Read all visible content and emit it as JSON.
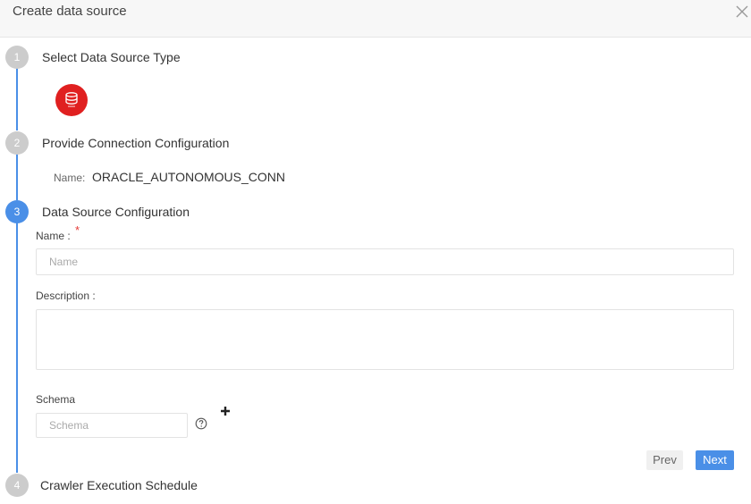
{
  "dialog": {
    "title": "Create data source"
  },
  "steps": [
    {
      "number": "1",
      "title": "Select Data Source Type"
    },
    {
      "number": "2",
      "title": "Provide Connection Configuration"
    },
    {
      "number": "3",
      "title": "Data Source Configuration"
    },
    {
      "number": "4",
      "title": "Crawler Execution Schedule"
    }
  ],
  "data_source_type": {
    "icon": "oracle-database-icon",
    "color": "#e02020"
  },
  "connection": {
    "name_label": "Name:",
    "name_value": "ORACLE_AUTONOMOUS_CONN"
  },
  "form": {
    "name_label": "Name :",
    "name_required_mark": "*",
    "name_placeholder": "Name",
    "description_label": "Description :",
    "schema_label": "Schema",
    "schema_placeholder": "Schema"
  },
  "buttons": {
    "prev": "Prev",
    "next": "Next"
  },
  "colors": {
    "accent": "#4a8fe7",
    "inactive_step": "#cccccc",
    "required": "#e53935"
  }
}
